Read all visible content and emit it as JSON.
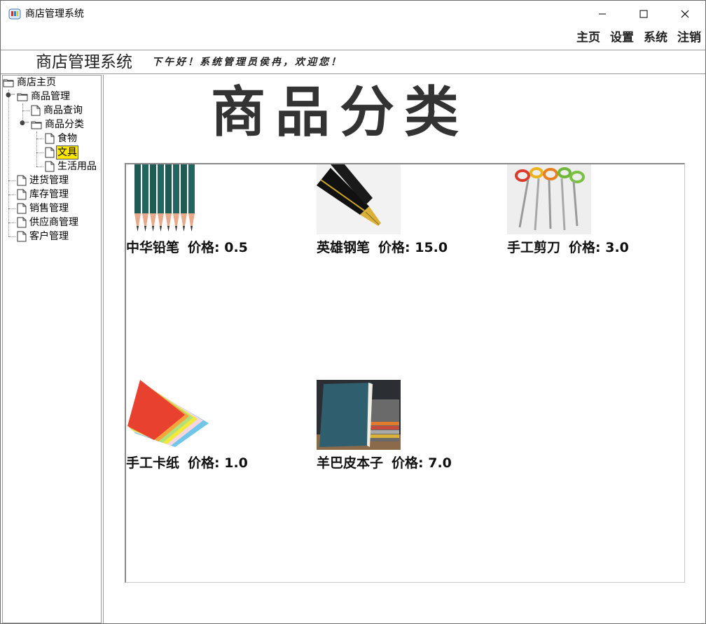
{
  "window": {
    "title": "商店管理系统"
  },
  "menu": [
    "主页",
    "设置",
    "系统",
    "注销"
  ],
  "header": {
    "brand": "商店管理系统",
    "greeting": "下午好！系统管理员侯冉，欢迎您！"
  },
  "tree": {
    "root": "商店主页",
    "goods_mgmt": "商品管理",
    "goods_query": "商品查询",
    "goods_category": "商品分类",
    "food": "食物",
    "stationery": "文具",
    "daily_use": "生活用品",
    "purchase_mgmt": "进货管理",
    "stock_mgmt": "库存管理",
    "sales_mgmt": "销售管理",
    "supplier_mgmt": "供应商管理",
    "customer_mgmt": "客户管理"
  },
  "main": {
    "title": "商品分类",
    "products": [
      {
        "name": "中华铅笔",
        "price_label": "价格: 0.5",
        "icon": "pencils-image"
      },
      {
        "name": "英雄钢笔",
        "price_label": "价格: 15.0",
        "icon": "fountain-pen-image"
      },
      {
        "name": "手工剪刀",
        "price_label": "价格: 3.0",
        "icon": "scissors-image"
      },
      {
        "name": "手工卡纸",
        "price_label": "价格: 1.0",
        "icon": "colored-paper-image"
      },
      {
        "name": "羊巴皮本子",
        "price_label": "价格: 7.0",
        "icon": "notebooks-image"
      }
    ]
  },
  "colors": {
    "selected_highlight": "#ffe600",
    "border": "#9a9a9a"
  }
}
